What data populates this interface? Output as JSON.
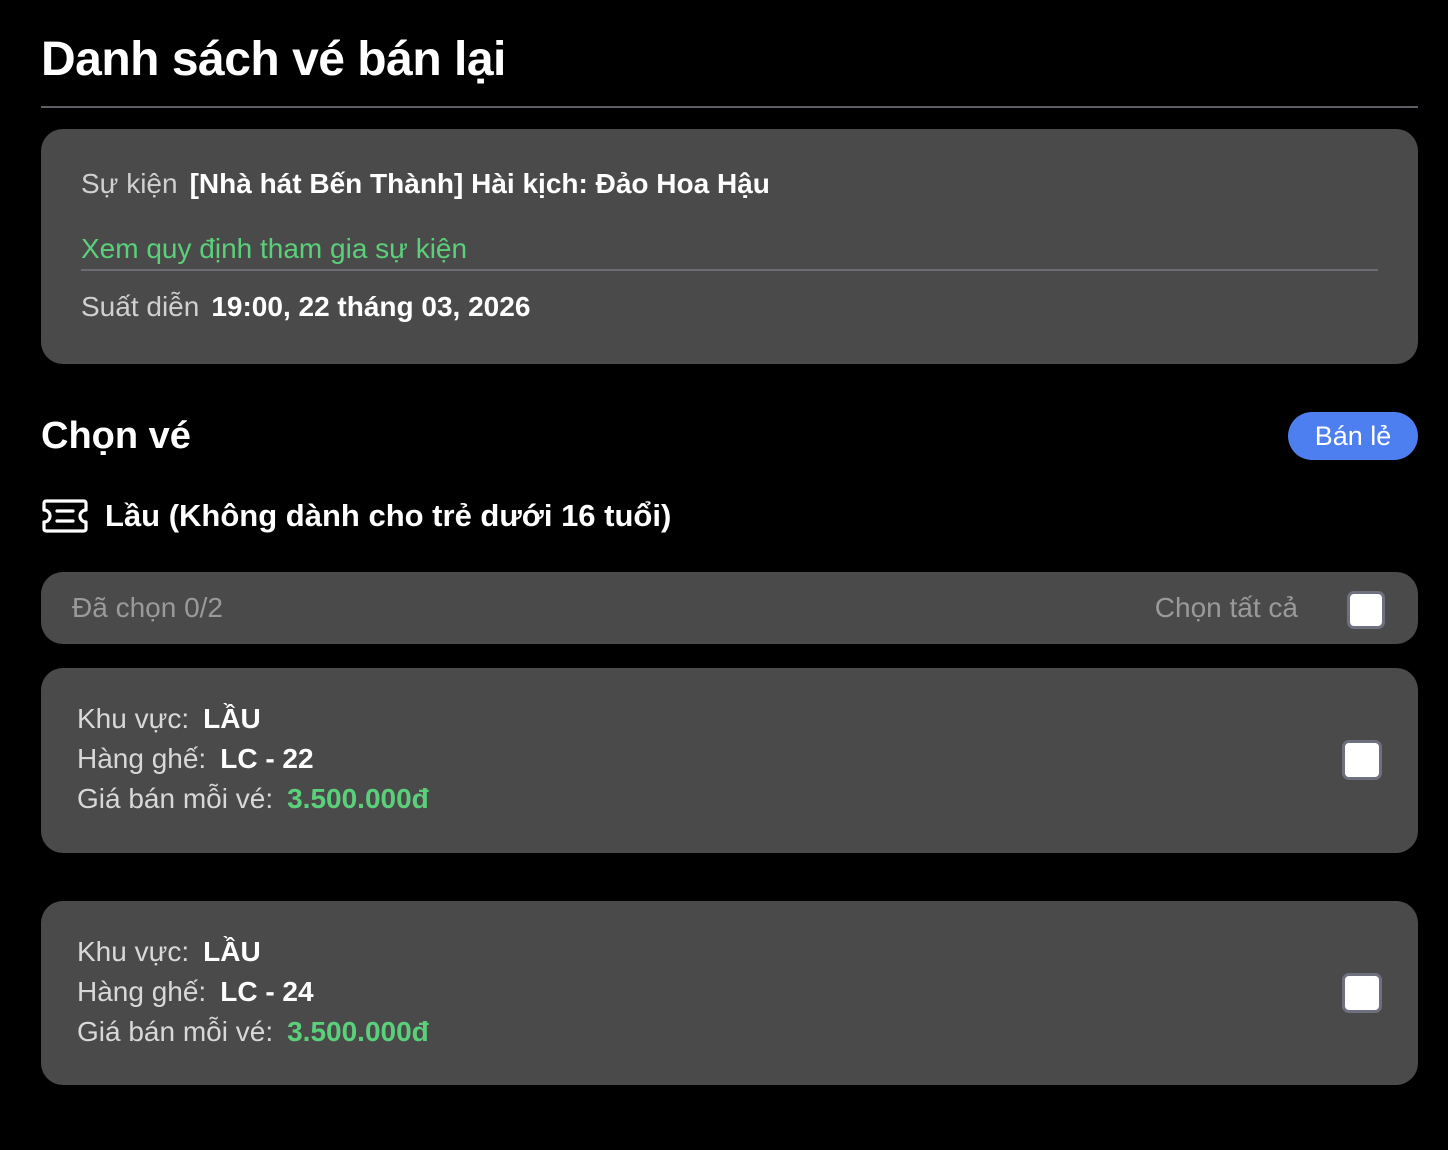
{
  "page": {
    "title": "Danh sách vé bán lại"
  },
  "event": {
    "event_label": "Sự kiện",
    "event_name": "[Nhà hát Bến Thành] Hài kịch: Đảo Hoa Hậu",
    "rules_link": "Xem quy định tham gia sự kiện",
    "show_label": "Suất diễn",
    "show_time": "19:00, 22 tháng 03, 2026"
  },
  "select_section": {
    "title": "Chọn vé",
    "retail_button": "Bán lẻ",
    "ticket_type_icon": "ticket-icon",
    "ticket_type": "Lầu (Không dành cho trẻ dưới 16 tuổi)",
    "selected_count": "Đã chọn 0/2",
    "select_all": "Chọn tất cả",
    "select_all_checked": false
  },
  "tickets": [
    {
      "area_label": "Khu vực:",
      "area": "LẦU",
      "row_label": "Hàng ghế:",
      "row": "LC - 22",
      "price_label": "Giá bán mỗi vé:",
      "price": "3.500.000đ",
      "checked": false
    },
    {
      "area_label": "Khu vực:",
      "area": "LẦU",
      "row_label": "Hàng ghế:",
      "row": "LC - 24",
      "price_label": "Giá bán mỗi vé:",
      "price": "3.500.000đ",
      "checked": false
    }
  ],
  "colors": {
    "background": "#000000",
    "card": "#4a4a4a",
    "accent_green": "#5bd07a",
    "button_blue": "#4e7ff0"
  }
}
